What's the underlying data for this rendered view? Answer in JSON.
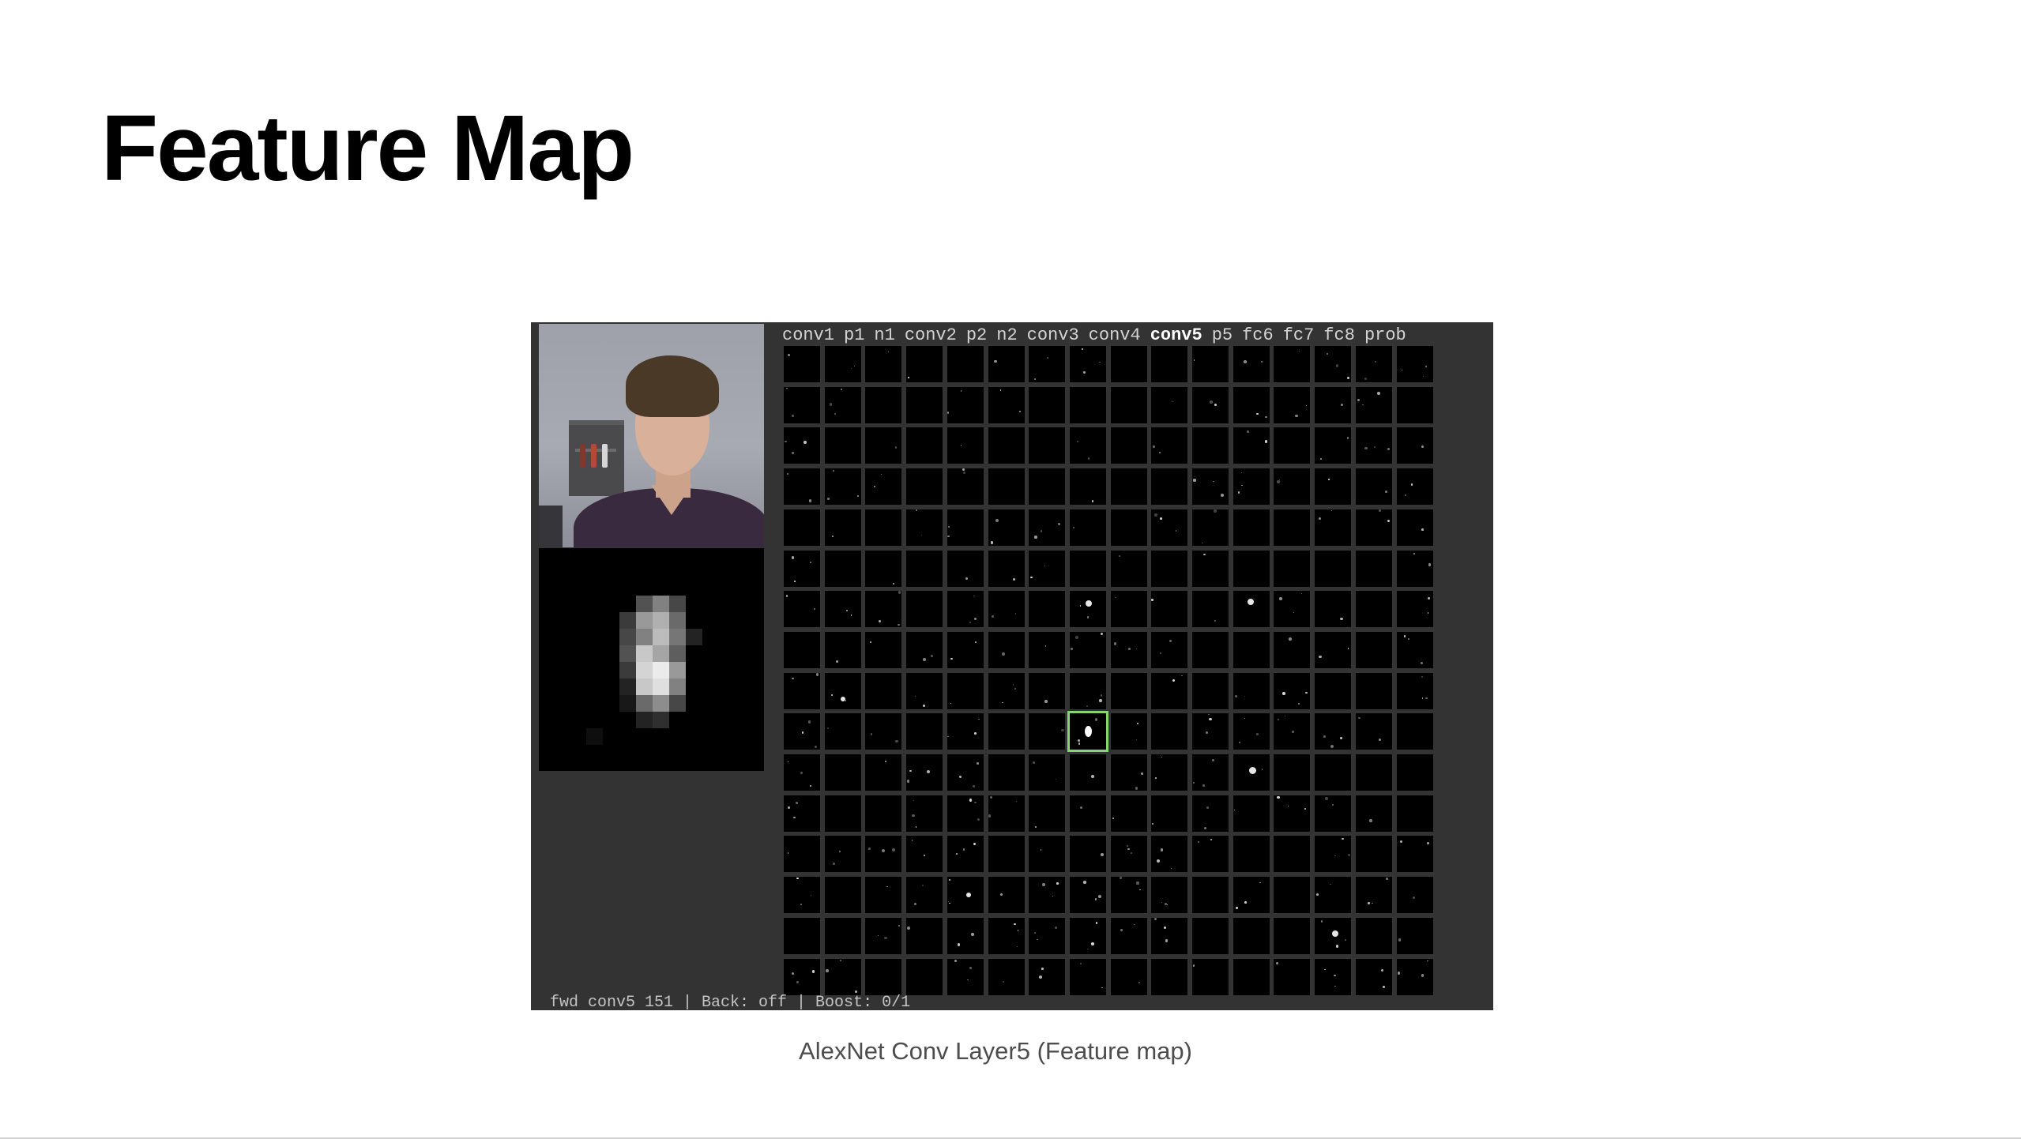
{
  "slide": {
    "title": "Feature Map",
    "caption": "AlexNet Conv Layer5 (Feature map)"
  },
  "visualizer": {
    "layer_tabs": [
      "conv1",
      "p1",
      "n1",
      "conv2",
      "p2",
      "n2",
      "conv3",
      "conv4",
      "conv5",
      "p5",
      "fc6",
      "fc7",
      "fc8",
      "prob"
    ],
    "active_layer": "conv5",
    "status_line": "fwd conv5 151 | Back: off | Boost: 0/1",
    "grid": {
      "columns": 16,
      "rows": 16,
      "selected_unit": {
        "row": 9,
        "column": 7
      }
    },
    "colors": {
      "frame": "#333333",
      "map_cell": "#000000",
      "selection": "#86d474",
      "active_tab": "#ffffff"
    }
  }
}
